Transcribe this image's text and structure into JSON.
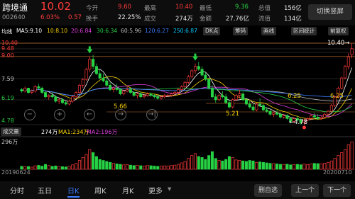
{
  "header": {
    "name": "跨境通",
    "code": "002640",
    "price": "10.02",
    "change_pct": "6.03%",
    "change": "0.57",
    "stats": [
      {
        "label": "今开",
        "value": "9.60",
        "tone": "red"
      },
      {
        "label": "最高",
        "value": "10.40",
        "tone": "red"
      },
      {
        "label": "最低",
        "value": "9.36",
        "tone": "green"
      },
      {
        "label": "总值",
        "value": "156亿",
        "tone": "plain"
      },
      {
        "label": "换手",
        "value": "22.25%",
        "tone": "plain"
      },
      {
        "label": "成交",
        "value": "274万",
        "tone": "plain"
      },
      {
        "label": "金额",
        "value": "27.76亿",
        "tone": "plain"
      },
      {
        "label": "流值",
        "value": "134亿",
        "tone": "plain"
      }
    ],
    "switch_button": "切换竖屏"
  },
  "ma_bar": {
    "items": [
      {
        "text": "均线",
        "color": "#ffffff"
      },
      {
        "text": "MA5:9.10",
        "color": "#ffffff"
      },
      {
        "text": "10:8.10",
        "color": "#f5d000"
      },
      {
        "text": "20:6.84",
        "color": "#e040e0"
      },
      {
        "text": "30:6.34",
        "color": "#27d144"
      },
      {
        "text": "60:5.96",
        "color": "#bbbbbb"
      },
      {
        "text": "120:6.27",
        "color": "#3b7cff"
      },
      {
        "text": "250:6.87",
        "color": "#00c8ff"
      }
    ],
    "chips": [
      "DK点",
      "筹码",
      "画线",
      "区间统计",
      "前复权"
    ]
  },
  "y_axis": [
    "10.40",
    "9.48",
    "9.00",
    "7.59",
    "6.19",
    "4.78"
  ],
  "annotations": {
    "high": "10.40→",
    "low": "←4.78",
    "level_a": "5.66",
    "level_b": "5.21",
    "level_c": "6.25",
    "level_d": "6.25"
  },
  "volume": {
    "label": "成交量",
    "value": "274万",
    "ma1": "MA1:234万",
    "ma2": "MA2:196万",
    "axis_top": "296万"
  },
  "dates": {
    "start": "20190624",
    "end": "20200710"
  },
  "tabs": [
    "分时",
    "五日",
    "日K",
    "周K",
    "月K",
    "更多"
  ],
  "active_tab": 2,
  "actions": {
    "remove_fav": "删自选",
    "prev": "上一个",
    "next": "下一个"
  },
  "colors": {
    "up": "#ff3b3b",
    "down": "#27d144",
    "accent": "#3b7cff"
  },
  "chart_data": {
    "type": "candlestick",
    "candles": [
      [
        7.2,
        7.3,
        7.0,
        7.1
      ],
      [
        7.1,
        7.4,
        7.0,
        7.3
      ],
      [
        7.3,
        7.3,
        6.9,
        7.0
      ],
      [
        7.0,
        7.2,
        6.9,
        7.1
      ],
      [
        7.1,
        7.5,
        7.0,
        7.4
      ],
      [
        7.4,
        7.6,
        7.2,
        7.3
      ],
      [
        7.3,
        7.4,
        6.9,
        7.0
      ],
      [
        7.0,
        7.1,
        6.6,
        6.7
      ],
      [
        6.7,
        6.9,
        6.5,
        6.8
      ],
      [
        6.8,
        7.0,
        6.6,
        6.7
      ],
      [
        6.7,
        6.8,
        6.3,
        6.4
      ],
      [
        6.4,
        6.6,
        6.2,
        6.5
      ],
      [
        6.5,
        6.6,
        6.2,
        6.3
      ],
      [
        6.3,
        6.4,
        6.1,
        6.2
      ],
      [
        6.2,
        6.5,
        6.1,
        6.4
      ],
      [
        6.4,
        6.8,
        6.3,
        6.7
      ],
      [
        6.7,
        7.1,
        6.6,
        7.0
      ],
      [
        7.0,
        7.6,
        6.9,
        7.5
      ],
      [
        7.5,
        8.0,
        7.3,
        7.9
      ],
      [
        7.9,
        8.7,
        7.8,
        8.6
      ],
      [
        8.6,
        9.5,
        8.4,
        9.3
      ],
      [
        9.3,
        9.6,
        8.6,
        8.8
      ],
      [
        8.8,
        9.0,
        8.2,
        8.3
      ],
      [
        8.3,
        8.6,
        7.9,
        8.0
      ],
      [
        8.0,
        8.3,
        7.7,
        7.8
      ],
      [
        7.8,
        8.1,
        7.4,
        7.5
      ],
      [
        7.5,
        7.7,
        7.1,
        7.2
      ],
      [
        7.2,
        7.4,
        7.0,
        7.3
      ],
      [
        7.3,
        7.6,
        7.1,
        7.2
      ],
      [
        7.2,
        7.3,
        6.8,
        6.9
      ],
      [
        6.9,
        7.2,
        6.8,
        7.1
      ],
      [
        7.1,
        7.4,
        7.0,
        7.2
      ],
      [
        7.2,
        7.3,
        6.9,
        7.0
      ],
      [
        7.0,
        7.1,
        6.7,
        6.8
      ],
      [
        6.8,
        7.0,
        6.6,
        6.9
      ],
      [
        6.9,
        7.0,
        6.6,
        6.7
      ],
      [
        6.7,
        6.9,
        6.6,
        6.8
      ],
      [
        6.8,
        7.0,
        6.7,
        6.9
      ],
      [
        6.9,
        7.0,
        6.7,
        6.8
      ],
      [
        6.8,
        6.9,
        6.6,
        6.7
      ],
      [
        6.7,
        6.8,
        6.5,
        6.6
      ],
      [
        6.6,
        6.8,
        6.5,
        6.7
      ],
      [
        6.7,
        6.9,
        6.6,
        6.8
      ],
      [
        6.8,
        6.9,
        6.7,
        6.8
      ],
      [
        6.8,
        7.0,
        6.7,
        6.9
      ],
      [
        6.9,
        7.1,
        6.8,
        7.0
      ],
      [
        7.0,
        7.3,
        6.9,
        7.2
      ],
      [
        7.2,
        7.5,
        7.1,
        7.4
      ],
      [
        7.4,
        7.8,
        7.3,
        7.7
      ],
      [
        7.7,
        8.2,
        7.6,
        8.1
      ],
      [
        8.1,
        8.6,
        8.0,
        8.5
      ],
      [
        8.5,
        9.0,
        8.3,
        8.8
      ],
      [
        8.8,
        9.1,
        8.5,
        8.6
      ],
      [
        8.6,
        8.8,
        8.1,
        8.2
      ],
      [
        8.2,
        8.4,
        7.8,
        7.9
      ],
      [
        7.9,
        8.0,
        7.2,
        7.3
      ],
      [
        7.3,
        7.5,
        6.6,
        6.7
      ],
      [
        6.7,
        6.9,
        6.3,
        6.5
      ],
      [
        6.5,
        6.9,
        6.4,
        6.8
      ],
      [
        6.8,
        7.1,
        6.6,
        6.7
      ],
      [
        6.7,
        6.9,
        6.2,
        6.3
      ],
      [
        6.3,
        6.5,
        5.9,
        6.0
      ],
      [
        6.0,
        6.6,
        5.9,
        6.5
      ],
      [
        6.5,
        6.9,
        6.4,
        6.8
      ],
      [
        6.8,
        7.2,
        6.6,
        6.9
      ],
      [
        6.9,
        7.0,
        6.4,
        6.5
      ],
      [
        6.5,
        6.6,
        6.1,
        6.2
      ],
      [
        6.2,
        6.4,
        5.9,
        6.0
      ],
      [
        6.0,
        6.2,
        5.7,
        5.8
      ],
      [
        5.8,
        6.3,
        5.7,
        6.2
      ],
      [
        6.2,
        6.6,
        6.0,
        6.1
      ],
      [
        6.1,
        6.2,
        5.7,
        5.8
      ],
      [
        5.8,
        6.0,
        5.6,
        5.7
      ],
      [
        5.7,
        5.8,
        5.4,
        5.5
      ],
      [
        5.5,
        5.7,
        5.3,
        5.6
      ],
      [
        5.6,
        5.8,
        5.4,
        5.5
      ],
      [
        5.5,
        5.6,
        5.2,
        5.3
      ],
      [
        5.3,
        5.5,
        5.2,
        5.4
      ],
      [
        5.4,
        5.5,
        5.1,
        5.2
      ],
      [
        5.2,
        5.3,
        4.9,
        5.0
      ],
      [
        5.0,
        5.3,
        4.9,
        5.2
      ],
      [
        5.2,
        5.4,
        5.0,
        5.1
      ],
      [
        5.1,
        5.2,
        4.8,
        4.9
      ],
      [
        4.9,
        5.2,
        4.78,
        5.1
      ],
      [
        5.1,
        5.3,
        5.0,
        5.2
      ],
      [
        5.2,
        5.5,
        5.1,
        5.4
      ],
      [
        5.4,
        5.6,
        5.2,
        5.3
      ],
      [
        5.3,
        5.5,
        5.1,
        5.2
      ],
      [
        5.2,
        5.4,
        5.1,
        5.3
      ],
      [
        5.3,
        5.6,
        5.2,
        5.5
      ],
      [
        5.5,
        5.8,
        5.4,
        5.7
      ],
      [
        5.7,
        6.2,
        5.6,
        6.1
      ],
      [
        6.1,
        6.8,
        6.0,
        6.7
      ],
      [
        6.7,
        7.4,
        6.6,
        7.3
      ],
      [
        7.3,
        8.1,
        7.2,
        8.0
      ],
      [
        8.0,
        8.9,
        7.9,
        8.8
      ],
      [
        8.8,
        9.7,
        8.6,
        9.45
      ],
      [
        9.6,
        10.4,
        9.36,
        10.02
      ]
    ],
    "volumes": [
      30,
      25,
      28,
      22,
      35,
      40,
      32,
      50,
      38,
      30,
      34,
      28,
      26,
      24,
      30,
      45,
      60,
      90,
      120,
      150,
      200,
      170,
      130,
      100,
      90,
      80,
      70,
      60,
      55,
      50,
      45,
      48,
      42,
      38,
      40,
      36,
      34,
      38,
      36,
      33,
      30,
      32,
      35,
      34,
      38,
      42,
      50,
      65,
      80,
      110,
      140,
      160,
      130,
      120,
      100,
      140,
      180,
      110,
      90,
      85,
      100,
      130,
      120,
      95,
      90,
      85,
      80,
      90,
      85,
      70,
      75,
      70,
      65,
      60,
      58,
      55,
      50,
      48,
      52,
      45,
      48,
      50,
      46,
      52,
      48,
      55,
      60,
      58,
      55,
      62,
      70,
      85,
      110,
      140,
      170,
      200,
      250,
      280
    ]
  }
}
